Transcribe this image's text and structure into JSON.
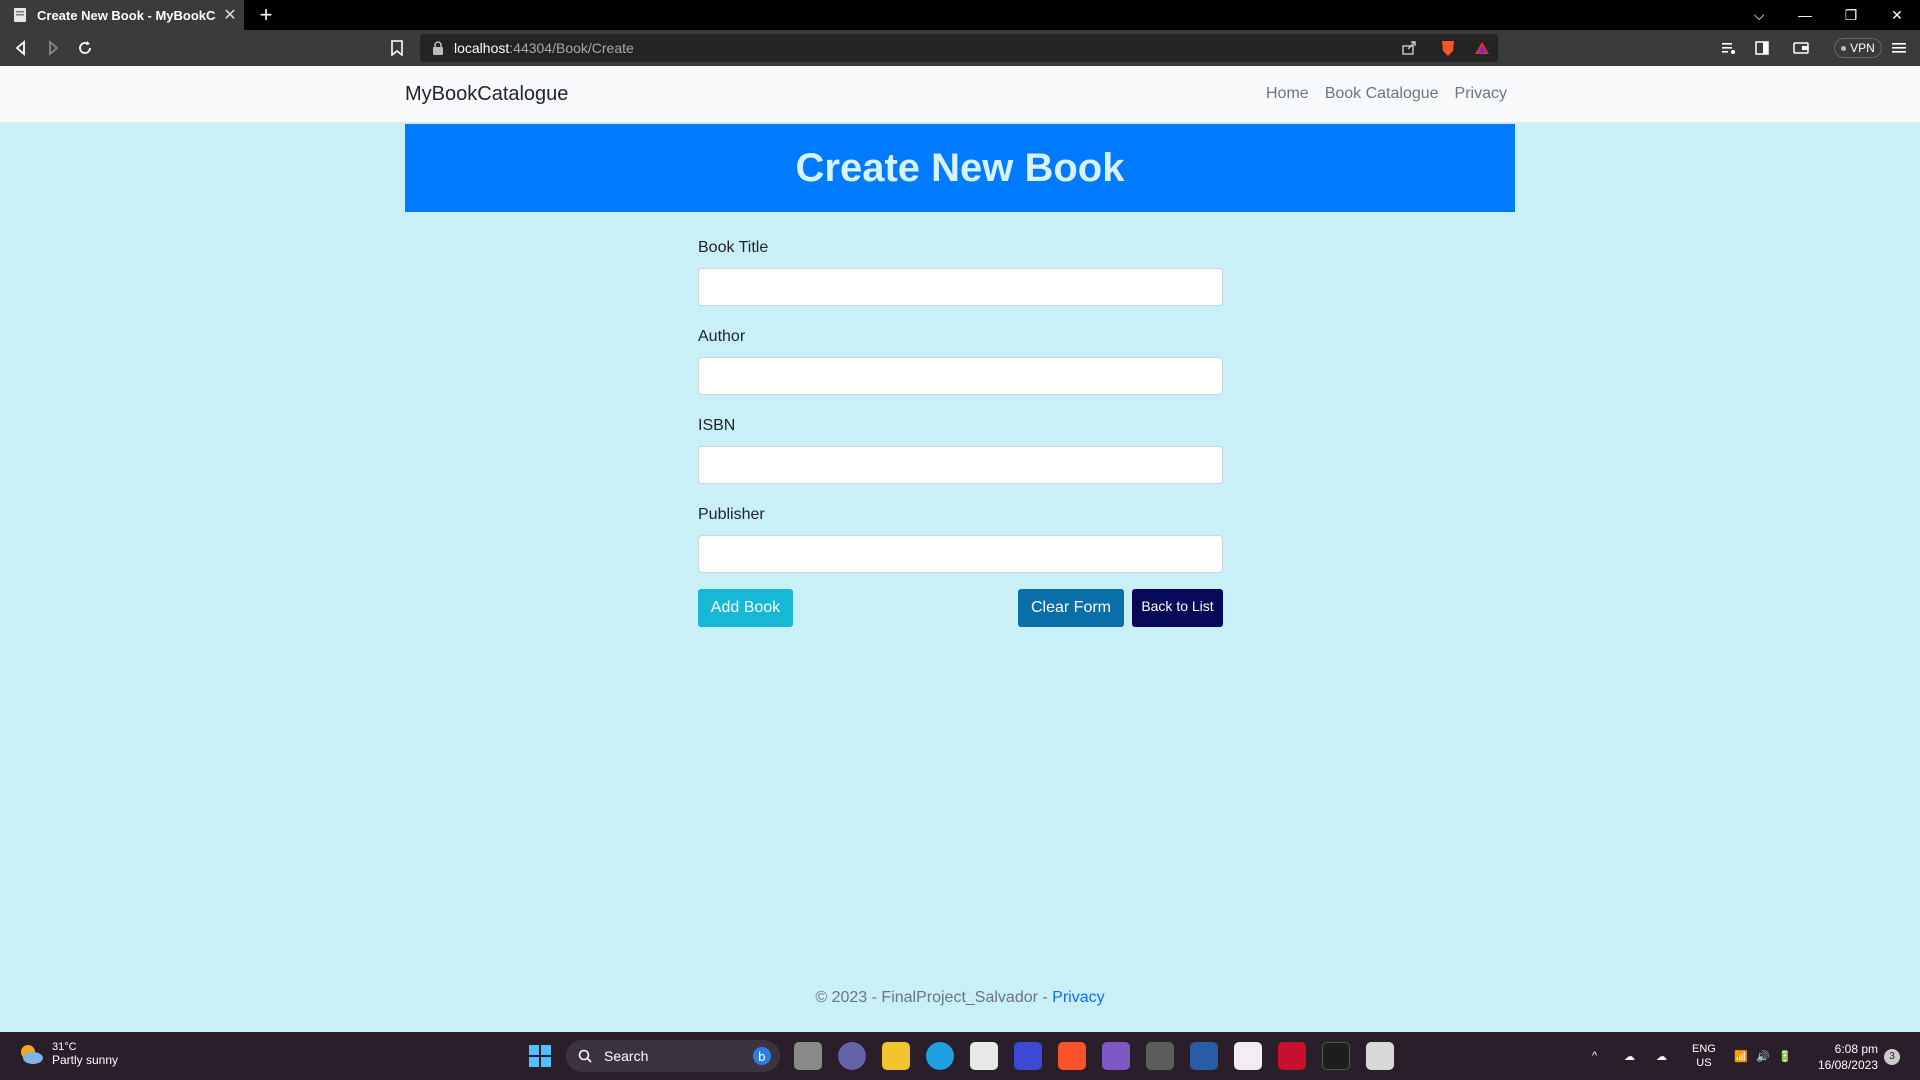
{
  "browser": {
    "tab_title": "Create New Book - MyBookCatalogue",
    "url_host": "localhost",
    "url_path": ":44304/Book/Create",
    "vpn_label": "VPN"
  },
  "navbar": {
    "brand": "MyBookCatalogue",
    "links": [
      "Home",
      "Book Catalogue",
      "Privacy"
    ]
  },
  "page": {
    "heading": "Create New Book"
  },
  "form": {
    "fields": [
      {
        "label": "Book Title",
        "value": ""
      },
      {
        "label": "Author",
        "value": ""
      },
      {
        "label": "ISBN",
        "value": ""
      },
      {
        "label": "Publisher",
        "value": ""
      }
    ],
    "add_label": "Add Book",
    "clear_label": "Clear Form",
    "back_label": "Back to List"
  },
  "footer": {
    "text": "© 2023 - FinalProject_Salvador - ",
    "link": "Privacy"
  },
  "taskbar": {
    "temp": "31°C",
    "condition": "Partly sunny",
    "search_label": "Search",
    "lang1": "ENG",
    "lang2": "US",
    "time": "6:08 pm",
    "date": "16/08/2023",
    "notifications": "3"
  },
  "colors": {
    "page_bg": "#c9eff7",
    "banner": "#007bff",
    "add_button": "#17b7d6",
    "clear_button": "#0a6fa8",
    "back_button": "#060b59"
  }
}
